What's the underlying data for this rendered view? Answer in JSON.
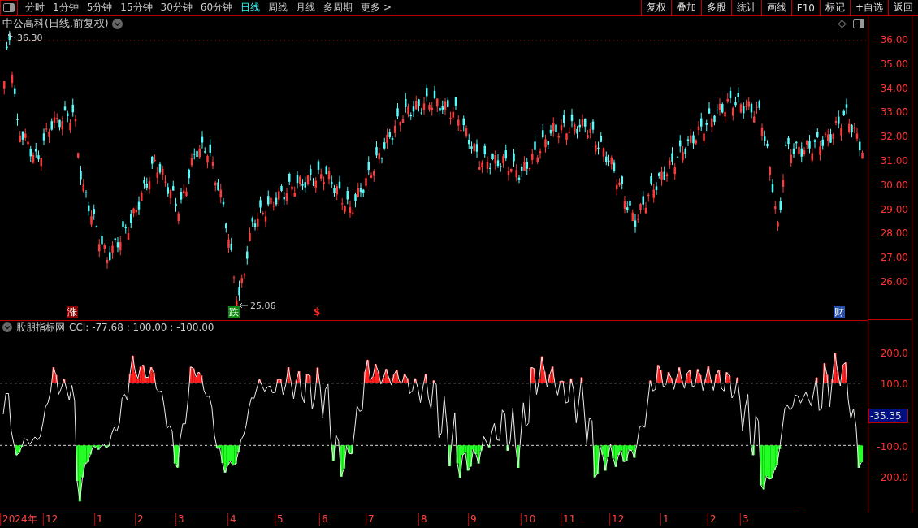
{
  "toolbar": {
    "periods": [
      {
        "label": "分时",
        "selected": false
      },
      {
        "label": "1分钟",
        "selected": false
      },
      {
        "label": "5分钟",
        "selected": false
      },
      {
        "label": "15分钟",
        "selected": false
      },
      {
        "label": "30分钟",
        "selected": false
      },
      {
        "label": "60分钟",
        "selected": false
      },
      {
        "label": "日线",
        "selected": true
      },
      {
        "label": "周线",
        "selected": false
      },
      {
        "label": "月线",
        "selected": false
      },
      {
        "label": "多周期",
        "selected": false
      },
      {
        "label": "更多 >",
        "selected": false
      }
    ],
    "buttons": [
      "复权",
      "叠加",
      "多股",
      "统计",
      "画线",
      "F10",
      "标记",
      "+自选",
      "返回"
    ]
  },
  "price_pane": {
    "title": "中公高科(日线.前复权)",
    "high_label": "36.30",
    "low_label": "25.06",
    "axis": [
      "36.00",
      "35.00",
      "34.00",
      "33.00",
      "32.00",
      "31.00",
      "30.00",
      "29.00",
      "28.00",
      "27.00",
      "26.00"
    ],
    "markers": [
      {
        "label": "涨",
        "kind": "rise"
      },
      {
        "label": "跌",
        "kind": "fall"
      },
      {
        "label": "$",
        "kind": "dollar"
      },
      {
        "label": "财",
        "kind": "finance"
      }
    ]
  },
  "indicator_pane": {
    "name": "股朋指标网",
    "readout": "CCI: -77.68 : 100.00 : -100.00",
    "axis": [
      "200.0",
      "100.0",
      "-100.0",
      "-200.0"
    ],
    "current": "-35.35"
  },
  "time_axis": [
    "2024年",
    "12",
    "1",
    "2",
    "3",
    "4",
    "5",
    "6",
    "7",
    "8",
    "9",
    "10",
    "11",
    "12",
    "1",
    "2",
    "3"
  ]
}
